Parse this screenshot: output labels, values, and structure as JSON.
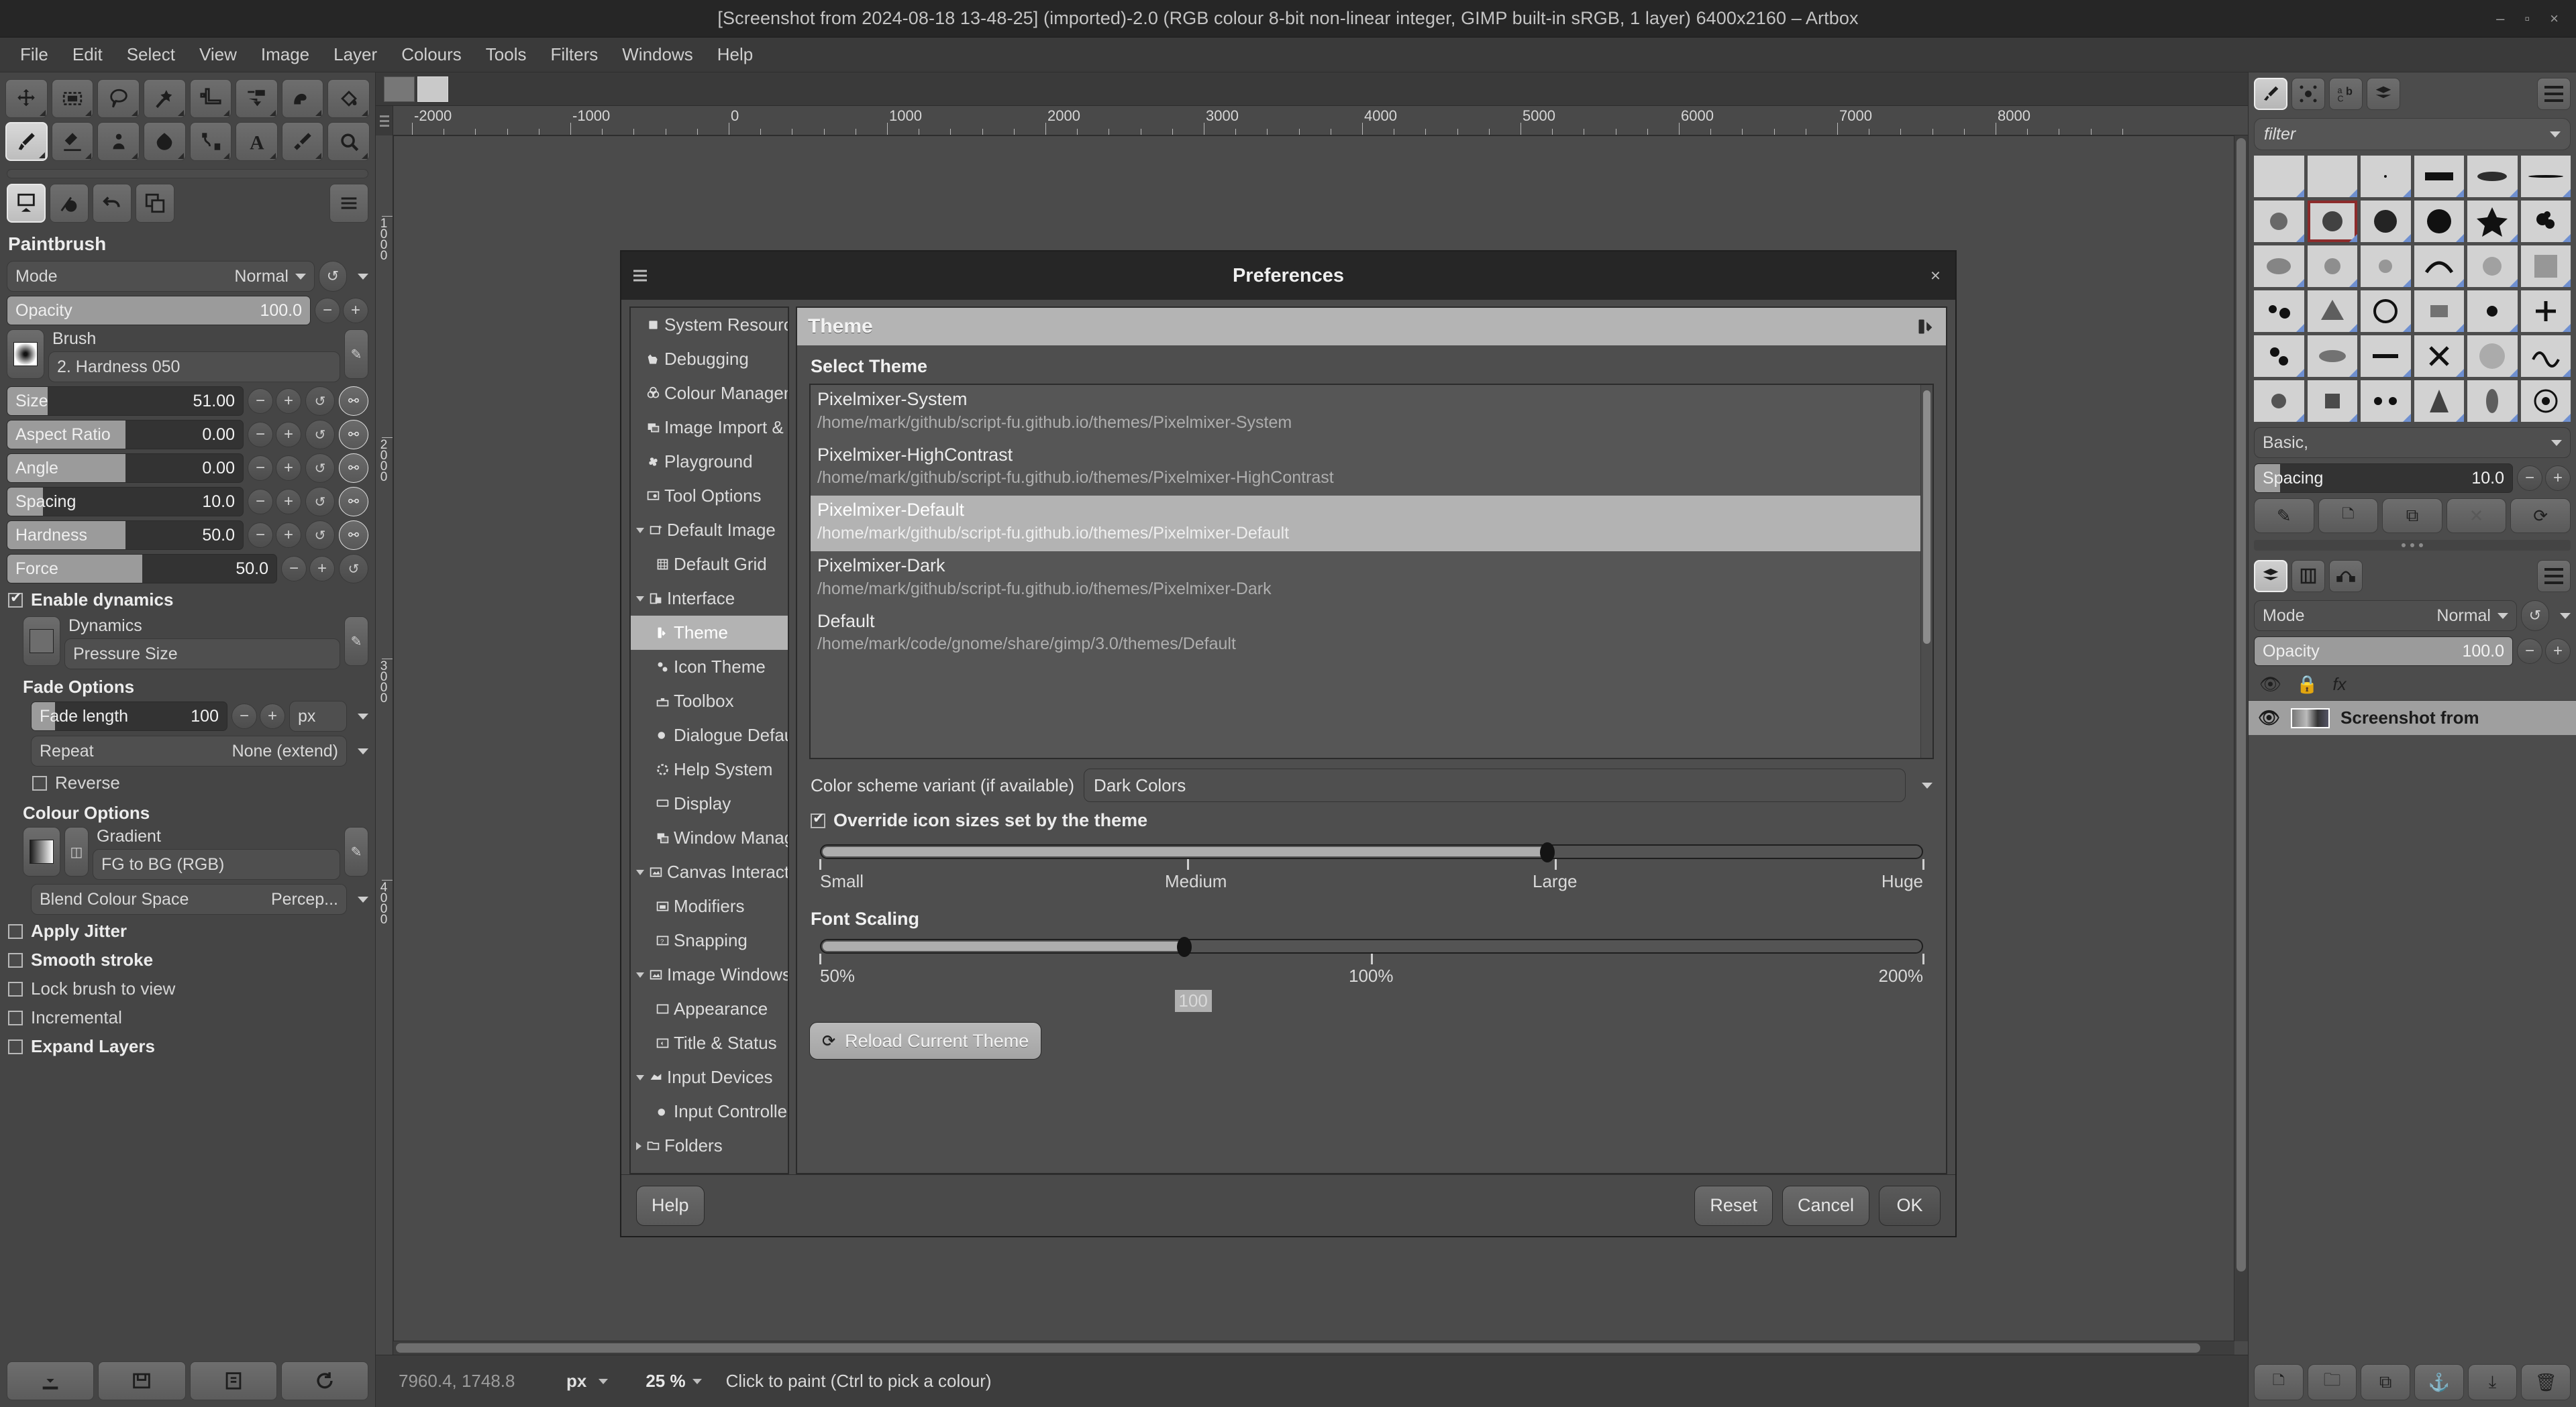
{
  "window": {
    "title": "[Screenshot from 2024-08-18 13-48-25] (imported)-2.0 (RGB colour 8-bit non-linear integer, GIMP built-in sRGB, 1 layer) 6400x2160 – Artbox",
    "minimize": "–",
    "maximize": "▫",
    "close": "×"
  },
  "menubar": {
    "items": [
      "File",
      "Edit",
      "Select",
      "View",
      "Image",
      "Layer",
      "Colours",
      "Tools",
      "Filters",
      "Windows",
      "Help"
    ]
  },
  "toolbox": {
    "tools": [
      {
        "name": "move-tool"
      },
      {
        "name": "rect-select-tool"
      },
      {
        "name": "free-select-tool"
      },
      {
        "name": "fuzzy-select-tool"
      },
      {
        "name": "crop-tool"
      },
      {
        "name": "transform-tool"
      },
      {
        "name": "warp-tool"
      },
      {
        "name": "bucket-fill-tool"
      },
      {
        "name": "paintbrush-tool"
      },
      {
        "name": "eraser-tool"
      },
      {
        "name": "clone-tool"
      },
      {
        "name": "smudge-tool"
      },
      {
        "name": "path-tool"
      },
      {
        "name": "text-tool"
      },
      {
        "name": "color-picker-tool"
      },
      {
        "name": "zoom-tool"
      }
    ],
    "selected_index": 8,
    "dock_buttons": [
      "canvas-icon",
      "info-icon",
      "undo-icon",
      "duplicate-icon"
    ],
    "dock_menu": "menu-icon"
  },
  "tool_options": {
    "title": "Paintbrush",
    "mode": {
      "label": "Mode",
      "value": "Normal"
    },
    "opacity": {
      "label": "Opacity",
      "value": "100.0",
      "fill_pct": 100
    },
    "brush": {
      "label": "Brush",
      "value": "2. Hardness 050"
    },
    "sliders": [
      {
        "label": "Size",
        "value": "51.00",
        "fill_pct": 17
      },
      {
        "label": "Aspect Ratio",
        "value": "0.00",
        "fill_pct": 50
      },
      {
        "label": "Angle",
        "value": "0.00",
        "fill_pct": 50
      },
      {
        "label": "Spacing",
        "value": "10.0",
        "fill_pct": 15
      },
      {
        "label": "Hardness",
        "value": "50.0",
        "fill_pct": 50
      },
      {
        "label": "Force",
        "value": "50.0",
        "fill_pct": 50
      }
    ],
    "enable_dynamics": {
      "label": "Enable dynamics",
      "checked": true
    },
    "dynamics": {
      "label": "Dynamics",
      "value": "Pressure Size"
    },
    "fade_options_title": "Fade Options",
    "fade_length": {
      "label": "Fade length",
      "value": "100",
      "unit": "px",
      "fill_pct": 12
    },
    "repeat": {
      "label": "Repeat",
      "value": "None (extend)"
    },
    "reverse": {
      "label": "Reverse",
      "checked": false
    },
    "colour_options_title": "Colour Options",
    "gradient": {
      "label": "Gradient",
      "value": "FG to BG (RGB)"
    },
    "blend_colour_space": {
      "label": "Blend Colour Space",
      "value": "Percep..."
    },
    "checkboxes": [
      {
        "label": "Apply Jitter",
        "checked": false,
        "bold": true
      },
      {
        "label": "Smooth stroke",
        "checked": false,
        "bold": true
      },
      {
        "label": "Lock brush to view",
        "checked": false,
        "bold": false
      },
      {
        "label": "Incremental",
        "checked": false,
        "bold": false
      },
      {
        "label": "Expand Layers",
        "checked": false,
        "bold": true
      }
    ]
  },
  "canvas": {
    "ruler_h_labels": [
      "-2000",
      "-1000",
      "0",
      "1000",
      "2000",
      "3000",
      "4000",
      "5000",
      "6000",
      "7000",
      "8000"
    ],
    "ruler_v_labels": [
      "1000",
      "2000",
      "3000",
      "4000"
    ]
  },
  "statusbar": {
    "position": "7960.4, 1748.8",
    "unit": "px",
    "zoom": "25 %",
    "hint": "Click to paint (Ctrl to pick a colour)"
  },
  "rightdock": {
    "tabs": [
      "brushes-icon",
      "patterns-icon",
      "fonts-icon",
      "layers-icon"
    ],
    "selected_tab": 0,
    "menu": "menu-icon",
    "filter": {
      "placeholder": "filter",
      "value": "filter"
    },
    "brush_selected_index": 7,
    "brush_preset": "Basic,",
    "spacing": {
      "label": "Spacing",
      "value": "10.0",
      "fill_pct": 10
    },
    "action_buttons": [
      "edit-icon",
      "new-icon",
      "duplicate-icon",
      "delete-icon",
      "refresh-icon"
    ],
    "layer_tabs": [
      "layers-icon",
      "channels-icon",
      "paths-icon"
    ],
    "layer_selected_tab": 0,
    "mode": {
      "label": "Mode",
      "value": "Normal"
    },
    "opacity": {
      "label": "Opacity",
      "value": "100.0",
      "fill_pct": 100
    },
    "lock_icons": [
      "eye-icon",
      "lock-icon",
      "fx-icon"
    ],
    "layer": {
      "name": "Screenshot from",
      "visible_icon": "eye-icon"
    },
    "bottom_buttons": [
      "new-layer-icon",
      "group-icon",
      "duplicate-icon",
      "anchor-icon",
      "merge-icon",
      "delete-icon"
    ]
  },
  "preferences": {
    "title": "Preferences",
    "menu_icon": "hamburger-icon",
    "close_icon": "close-icon",
    "nav": [
      {
        "label": "System Resources",
        "icon": "chip-icon",
        "indent": 0,
        "tri": "none",
        "selected": false
      },
      {
        "label": "Debugging",
        "icon": "wilber-icon",
        "indent": 0,
        "tri": "none",
        "selected": false
      },
      {
        "label": "Colour Management",
        "icon": "colour-icon",
        "indent": 0,
        "tri": "none",
        "selected": false
      },
      {
        "label": "Image Import & Export",
        "icon": "import-export-icon",
        "indent": 0,
        "tri": "none",
        "selected": false
      },
      {
        "label": "Playground",
        "icon": "playground-icon",
        "indent": 0,
        "tri": "none",
        "selected": false
      },
      {
        "label": "Tool Options",
        "icon": "tool-options-icon",
        "indent": 0,
        "tri": "none",
        "selected": false
      },
      {
        "label": "Default Image",
        "icon": "default-image-icon",
        "indent": 0,
        "tri": "open",
        "selected": false
      },
      {
        "label": "Default Grid",
        "icon": "grid-icon",
        "indent": 1,
        "tri": "none",
        "selected": false
      },
      {
        "label": "Interface",
        "icon": "interface-icon",
        "indent": 0,
        "tri": "open",
        "selected": false
      },
      {
        "label": "Theme",
        "icon": "theme-icon",
        "indent": 1,
        "tri": "none",
        "selected": true
      },
      {
        "label": "Icon Theme",
        "icon": "icon-theme-icon",
        "indent": 1,
        "tri": "none",
        "selected": false
      },
      {
        "label": "Toolbox",
        "icon": "toolbox-icon",
        "indent": 1,
        "tri": "none",
        "selected": false
      },
      {
        "label": "Dialogue Defaults",
        "icon": "dialogue-icon",
        "indent": 1,
        "tri": "none",
        "selected": false
      },
      {
        "label": "Help System",
        "icon": "help-icon",
        "indent": 1,
        "tri": "none",
        "selected": false
      },
      {
        "label": "Display",
        "icon": "display-icon",
        "indent": 1,
        "tri": "none",
        "selected": false
      },
      {
        "label": "Window Management",
        "icon": "window-mgmt-icon",
        "indent": 1,
        "tri": "none",
        "selected": false
      },
      {
        "label": "Canvas Interaction",
        "icon": "canvas-icon",
        "indent": 0,
        "tri": "open",
        "selected": false
      },
      {
        "label": "Modifiers",
        "icon": "modifiers-icon",
        "indent": 1,
        "tri": "none",
        "selected": false
      },
      {
        "label": "Snapping",
        "icon": "snapping-icon",
        "indent": 1,
        "tri": "none",
        "selected": false
      },
      {
        "label": "Image Windows",
        "icon": "image-windows-icon",
        "indent": 0,
        "tri": "open",
        "selected": false
      },
      {
        "label": "Appearance",
        "icon": "appearance-icon",
        "indent": 1,
        "tri": "none",
        "selected": false
      },
      {
        "label": "Title & Status",
        "icon": "title-status-icon",
        "indent": 1,
        "tri": "none",
        "selected": false
      },
      {
        "label": "Input Devices",
        "icon": "input-devices-icon",
        "indent": 0,
        "tri": "open",
        "selected": false
      },
      {
        "label": "Input Controllers",
        "icon": "input-controllers-icon",
        "indent": 1,
        "tri": "none",
        "selected": false
      },
      {
        "label": "Folders",
        "icon": "folders-icon",
        "indent": 0,
        "tri": "closed",
        "selected": false
      }
    ],
    "pane_title": "Theme",
    "select_theme_label": "Select Theme",
    "themes": [
      {
        "name": "Default",
        "path": "/home/mark/code/gnome/share/gimp/3.0/themes/Default",
        "selected": false
      },
      {
        "name": "Pixelmixer-Dark",
        "path": "/home/mark/github/script-fu.github.io/themes/Pixelmixer-Dark",
        "selected": false
      },
      {
        "name": "Pixelmixer-Default",
        "path": "/home/mark/github/script-fu.github.io/themes/Pixelmixer-Default",
        "selected": true
      },
      {
        "name": "Pixelmixer-HighContrast",
        "path": "/home/mark/github/script-fu.github.io/themes/Pixelmixer-HighContrast",
        "selected": false
      },
      {
        "name": "Pixelmixer-System",
        "path": "/home/mark/github/script-fu.github.io/themes/Pixelmixer-System",
        "selected": false
      }
    ],
    "colour_scheme": {
      "label": "Color scheme variant (if available)",
      "value": "Dark Colors"
    },
    "override_icon_sizes": {
      "label": "Override icon sizes set by the theme",
      "checked": true
    },
    "icon_size_slider": {
      "ticks": [
        "Small",
        "Medium",
        "Large",
        "Huge"
      ],
      "value_pct": 66
    },
    "font_scaling_title": "Font Scaling",
    "font_scaling_slider": {
      "ticks": [
        "50%",
        "100%",
        "200%"
      ],
      "value_pct": 33,
      "value": "100"
    },
    "reload_button": {
      "label": "Reload Current Theme",
      "icon": "refresh-icon"
    },
    "buttons": {
      "help": "Help",
      "reset": "Reset",
      "cancel": "Cancel",
      "ok": "OK"
    }
  }
}
